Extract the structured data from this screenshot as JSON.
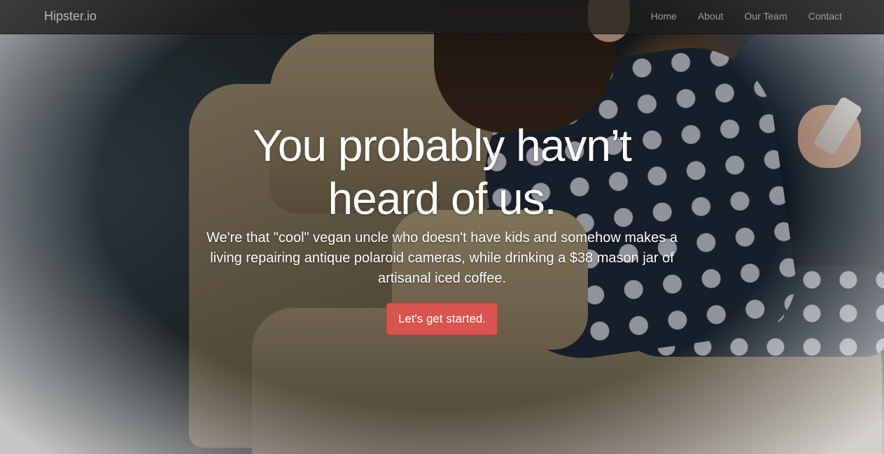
{
  "navbar": {
    "brand": "Hipster.io",
    "links": [
      {
        "label": "Home"
      },
      {
        "label": "About"
      },
      {
        "label": "Our Team"
      },
      {
        "label": "Contact"
      }
    ]
  },
  "hero": {
    "headline": "You probably havn’t heard of us.",
    "lead": "We're that \"cool\" vegan uncle who doesn't have kids and somehow makes a living repairing antique polaroid cameras, while drinking a $38 mason jar of artisanal iced coffee.",
    "cta_label": "Let's get started.",
    "background_image": "woman-in-polka-dot-dress-on-armchair-with-phone"
  },
  "colors": {
    "navbar_bg": "#1e1e1e",
    "nav_link": "#9d9d9d",
    "brand": "#b8b8b8",
    "cta_bg": "#d9534f",
    "text": "#ffffff"
  }
}
